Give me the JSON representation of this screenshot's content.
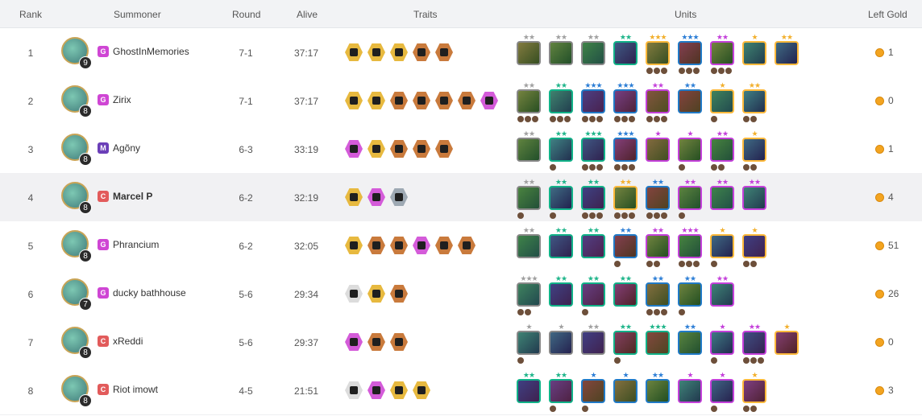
{
  "columns": {
    "rank": "Rank",
    "summoner": "Summoner",
    "round": "Round",
    "alive": "Alive",
    "traits": "Traits",
    "units": "Units",
    "gold": "Left Gold"
  },
  "colors": {
    "tier_gold": "#e7b93f",
    "tier_bronze": "#c97a3c",
    "tier_chromatic": "#d45bd9",
    "tier_silver": "#9ea9b3",
    "cost_1": "#888888",
    "cost_2": "#11b288",
    "cost_3": "#207ac7",
    "cost_4": "#c440da",
    "cost_5": "#ffb93b",
    "star_1": "#a0a0a0",
    "star_2": "#1fb58a",
    "star_3": "#2e7fd6",
    "star_4": "#c440da",
    "star_5": "#f2b02e",
    "coin": "#f3a420",
    "badge_G": "#cf46d4",
    "badge_M": "#6b3fb8",
    "badge_C": "#e25b5b"
  },
  "rows": [
    {
      "rank": "1",
      "name": "GhostInMemories",
      "level": "9",
      "badge": "G",
      "round": "7-1",
      "alive": "37:17",
      "gold": "1",
      "highlight": false,
      "bold": false,
      "traits": [
        "gold",
        "gold",
        "gold",
        "bronze",
        "bronze"
      ],
      "units": [
        {
          "cost": 1,
          "stars": 2,
          "items": 0
        },
        {
          "cost": 1,
          "stars": 2,
          "items": 0
        },
        {
          "cost": 1,
          "stars": 2,
          "items": 0
        },
        {
          "cost": 2,
          "stars": 2,
          "items": 0
        },
        {
          "cost": 5,
          "stars": 3,
          "items": 3
        },
        {
          "cost": 3,
          "stars": 3,
          "items": 3
        },
        {
          "cost": 4,
          "stars": 2,
          "items": 3
        },
        {
          "cost": 5,
          "stars": 1,
          "items": 0
        },
        {
          "cost": 5,
          "stars": 2,
          "items": 0
        }
      ]
    },
    {
      "rank": "2",
      "name": "Zirix",
      "level": "8",
      "badge": "G",
      "round": "7-1",
      "alive": "37:17",
      "gold": "0",
      "highlight": false,
      "bold": false,
      "traits": [
        "gold",
        "gold",
        "bronze",
        "bronze",
        "bronze",
        "bronze",
        "chromatic"
      ],
      "units": [
        {
          "cost": 1,
          "stars": 2,
          "items": 3
        },
        {
          "cost": 2,
          "stars": 2,
          "items": 3
        },
        {
          "cost": 3,
          "stars": 3,
          "items": 3
        },
        {
          "cost": 3,
          "stars": 3,
          "items": 3
        },
        {
          "cost": 4,
          "stars": 2,
          "items": 3
        },
        {
          "cost": 3,
          "stars": 2,
          "items": 0
        },
        {
          "cost": 5,
          "stars": 1,
          "items": 1
        },
        {
          "cost": 5,
          "stars": 2,
          "items": 2
        }
      ]
    },
    {
      "rank": "3",
      "name": "Agõny",
      "level": "8",
      "badge": "M",
      "round": "6-3",
      "alive": "33:19",
      "gold": "1",
      "highlight": false,
      "bold": false,
      "traits": [
        "chromatic",
        "gold",
        "bronze",
        "bronze",
        "bronze"
      ],
      "units": [
        {
          "cost": 1,
          "stars": 2,
          "items": 0
        },
        {
          "cost": 2,
          "stars": 2,
          "items": 1
        },
        {
          "cost": 2,
          "stars": 3,
          "items": 3
        },
        {
          "cost": 3,
          "stars": 3,
          "items": 3
        },
        {
          "cost": 4,
          "stars": 1,
          "items": 0
        },
        {
          "cost": 4,
          "stars": 1,
          "items": 1
        },
        {
          "cost": 4,
          "stars": 2,
          "items": 2
        },
        {
          "cost": 5,
          "stars": 1,
          "items": 2
        }
      ]
    },
    {
      "rank": "4",
      "name": "Marcel P",
      "level": "8",
      "badge": "C",
      "round": "6-2",
      "alive": "32:19",
      "gold": "4",
      "highlight": true,
      "bold": true,
      "traits": [
        "gold",
        "chromatic",
        "silver"
      ],
      "units": [
        {
          "cost": 1,
          "stars": 2,
          "items": 1
        },
        {
          "cost": 2,
          "stars": 2,
          "items": 1
        },
        {
          "cost": 2,
          "stars": 2,
          "items": 3
        },
        {
          "cost": 5,
          "stars": 2,
          "items": 3
        },
        {
          "cost": 3,
          "stars": 2,
          "items": 3
        },
        {
          "cost": 4,
          "stars": 2,
          "items": 1
        },
        {
          "cost": 4,
          "stars": 2,
          "items": 0
        },
        {
          "cost": 4,
          "stars": 2,
          "items": 0
        }
      ]
    },
    {
      "rank": "5",
      "name": "Phrancium",
      "level": "8",
      "badge": "G",
      "round": "6-2",
      "alive": "32:05",
      "gold": "51",
      "highlight": false,
      "bold": false,
      "traits": [
        "gold",
        "bronze",
        "bronze",
        "chromatic",
        "bronze",
        "bronze"
      ],
      "units": [
        {
          "cost": 1,
          "stars": 2,
          "items": 0
        },
        {
          "cost": 2,
          "stars": 2,
          "items": 0
        },
        {
          "cost": 2,
          "stars": 2,
          "items": 0
        },
        {
          "cost": 3,
          "stars": 2,
          "items": 1
        },
        {
          "cost": 4,
          "stars": 2,
          "items": 2
        },
        {
          "cost": 4,
          "stars": 3,
          "items": 3
        },
        {
          "cost": 5,
          "stars": 1,
          "items": 1
        },
        {
          "cost": 5,
          "stars": 1,
          "items": 2
        }
      ]
    },
    {
      "rank": "6",
      "name": "ducky bathhouse",
      "level": "7",
      "badge": "G",
      "round": "5-6",
      "alive": "29:34",
      "gold": "26",
      "highlight": false,
      "bold": false,
      "traits": [
        "plain",
        "gold",
        "bronze"
      ],
      "units": [
        {
          "cost": 1,
          "stars": 3,
          "items": 2
        },
        {
          "cost": 2,
          "stars": 2,
          "items": 0
        },
        {
          "cost": 2,
          "stars": 2,
          "items": 1
        },
        {
          "cost": 2,
          "stars": 2,
          "items": 0
        },
        {
          "cost": 3,
          "stars": 2,
          "items": 3
        },
        {
          "cost": 3,
          "stars": 2,
          "items": 1
        },
        {
          "cost": 4,
          "stars": 2,
          "items": 0
        }
      ]
    },
    {
      "rank": "7",
      "name": "xReddi",
      "level": "8",
      "badge": "C",
      "round": "5-6",
      "alive": "29:37",
      "gold": "0",
      "highlight": false,
      "bold": false,
      "traits": [
        "chromatic",
        "bronze",
        "bronze"
      ],
      "units": [
        {
          "cost": 1,
          "stars": 1,
          "items": 1
        },
        {
          "cost": 1,
          "stars": 1,
          "items": 0
        },
        {
          "cost": 1,
          "stars": 2,
          "items": 0
        },
        {
          "cost": 2,
          "stars": 2,
          "items": 1
        },
        {
          "cost": 2,
          "stars": 3,
          "items": 0
        },
        {
          "cost": 3,
          "stars": 2,
          "items": 0
        },
        {
          "cost": 4,
          "stars": 1,
          "items": 1
        },
        {
          "cost": 4,
          "stars": 2,
          "items": 3
        },
        {
          "cost": 5,
          "stars": 1,
          "items": 0
        }
      ]
    },
    {
      "rank": "8",
      "name": "Riot imowt",
      "level": "8",
      "badge": "C",
      "round": "4-5",
      "alive": "21:51",
      "gold": "3",
      "highlight": false,
      "bold": false,
      "traits": [
        "plain",
        "chromatic",
        "gold",
        "gold"
      ],
      "units": [
        {
          "cost": 2,
          "stars": 2,
          "items": 0
        },
        {
          "cost": 2,
          "stars": 2,
          "items": 1
        },
        {
          "cost": 3,
          "stars": 1,
          "items": 1
        },
        {
          "cost": 3,
          "stars": 1,
          "items": 0
        },
        {
          "cost": 3,
          "stars": 2,
          "items": 0
        },
        {
          "cost": 4,
          "stars": 1,
          "items": 0
        },
        {
          "cost": 4,
          "stars": 1,
          "items": 1
        },
        {
          "cost": 5,
          "stars": 1,
          "items": 2
        }
      ]
    }
  ]
}
